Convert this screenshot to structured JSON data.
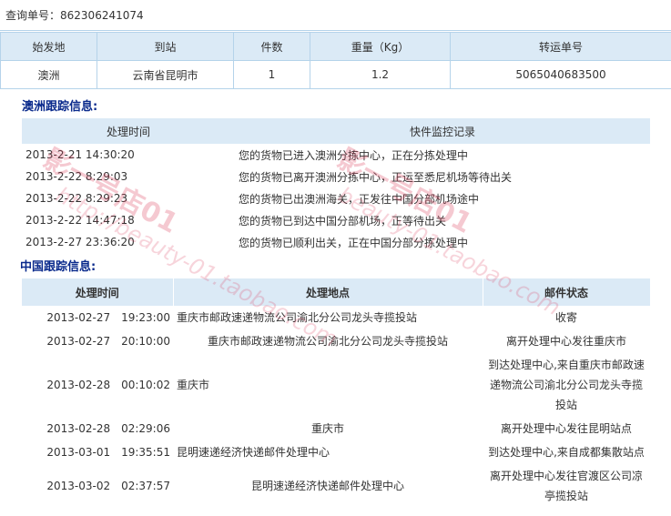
{
  "query": {
    "label": "查询单号：",
    "number": "862306241074"
  },
  "summary": {
    "headers": [
      "始发地",
      "到站",
      "件数",
      "重量（Kg）",
      "转运单号"
    ],
    "row": [
      "澳洲",
      "云南省昆明市",
      "1",
      "1.2",
      "5065040683500"
    ]
  },
  "australia": {
    "title": "澳洲跟踪信息:",
    "headers": [
      "处理时间",
      "快件监控记录"
    ],
    "rows": [
      [
        "2013-2-21 14:30:20",
        "您的货物已进入澳洲分拣中心，正在分拣处理中"
      ],
      [
        "2013-2-22 8:29:03",
        "您的货物已离开澳洲分拣中心，正运至悉尼机场等待出关"
      ],
      [
        "2013-2-22 8:29:23",
        "您的货物已出澳洲海关，正发往中国分部机场途中"
      ],
      [
        "2013-2-22 14:47:18",
        "您的货物已到达中国分部机场，正等待出关"
      ],
      [
        "2013-2-27 23:36:20",
        "您的货物已顺利出关，正在中国分部分拣处理中"
      ]
    ]
  },
  "china": {
    "title": "中国跟踪信息:",
    "headers": [
      "处理时间",
      "处理地点",
      "邮件状态"
    ],
    "rows": [
      {
        "time": "2013-02-27　19:23:00",
        "place": "重庆市邮政速递物流公司渝北分公司龙头寺揽投站",
        "place_align": "left",
        "status": "收寄"
      },
      {
        "time": "2013-02-27　20:10:00",
        "place": "重庆市邮政速递物流公司渝北分公司龙头寺揽投站",
        "place_align": "center",
        "status": "离开处理中心发往重庆市"
      },
      {
        "time": "2013-02-28　00:10:02",
        "place": "重庆市",
        "place_align": "left",
        "status": "到达处理中心,来自重庆市邮政速递物流公司渝北分公司龙头寺揽投站"
      },
      {
        "time": "2013-02-28　02:29:06",
        "place": "重庆市",
        "place_align": "center",
        "status": "离开处理中心发往昆明站点"
      },
      {
        "time": "2013-03-01　19:35:51",
        "place": "昆明速递经济快递邮件处理中心",
        "place_align": "left",
        "status": "到达处理中心,来自成都集散站点"
      },
      {
        "time": "2013-03-02　02:37:57",
        "place": "昆明速递经济快递邮件处理中心",
        "place_align": "center",
        "status": "离开处理中心发往官渡区公司凉亭揽投站"
      }
    ]
  },
  "watermark": {
    "shop": "影一号店01",
    "url1": "http://beauty-01.taobao.com",
    "url2": "beauty-01.taobao.com",
    "color": "#dc3c5a"
  }
}
